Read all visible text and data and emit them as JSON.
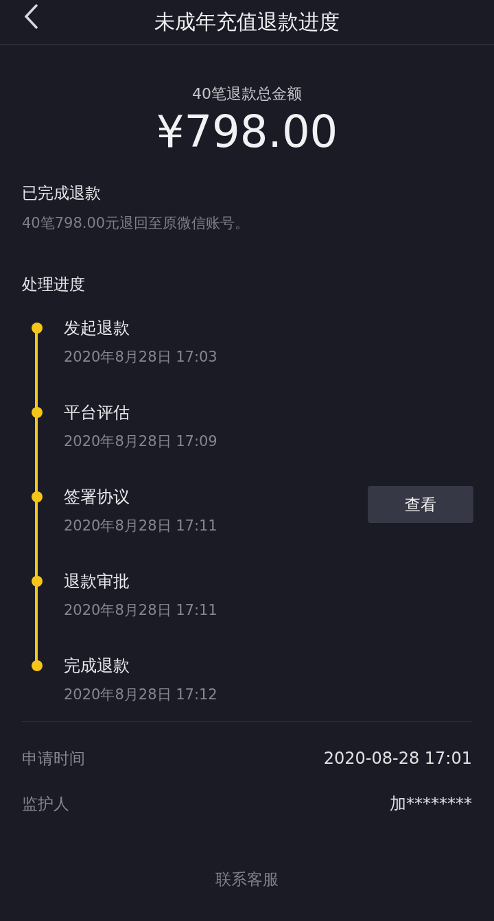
{
  "header": {
    "title": "未成年充值退款进度"
  },
  "summary": {
    "caption": "40笔退款总金额",
    "amount": "¥798.00"
  },
  "status": {
    "title": "已完成退款",
    "description": "40笔798.00元退回至原微信账号。"
  },
  "progress": {
    "title": "处理进度",
    "steps": [
      {
        "title": "发起退款",
        "time": "2020年8月28日 17:03"
      },
      {
        "title": "平台评估",
        "time": "2020年8月28日 17:09"
      },
      {
        "title": "签署协议",
        "time": "2020年8月28日 17:11",
        "action": "查看"
      },
      {
        "title": "退款审批",
        "time": "2020年8月28日 17:11"
      },
      {
        "title": "完成退款",
        "time": "2020年8月28日 17:12"
      }
    ]
  },
  "details": [
    {
      "label": "申请时间",
      "value": "2020-08-28 17:01"
    },
    {
      "label": "监护人",
      "value": "加********"
    }
  ],
  "footer": {
    "link": "联系客服"
  }
}
